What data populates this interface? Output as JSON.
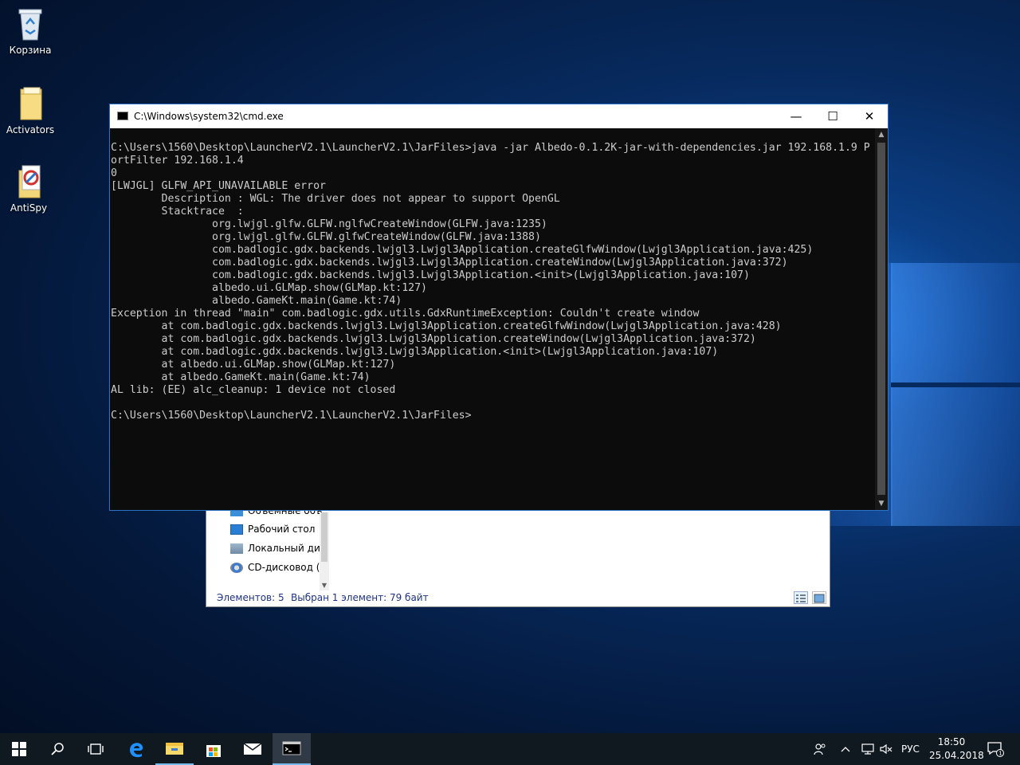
{
  "desktop": {
    "icons": [
      {
        "label": "Корзина"
      },
      {
        "label": "Activators"
      },
      {
        "label": "AntiSpy"
      }
    ]
  },
  "explorer": {
    "nav_items": [
      {
        "label": "Объемные объ"
      },
      {
        "label": "Рабочий стол"
      },
      {
        "label": "Локальный дис"
      },
      {
        "label": "CD-дисковод (D"
      }
    ],
    "status_count": "Элементов: 5",
    "status_selected": "Выбран 1 элемент: 79 байт"
  },
  "cmd": {
    "title": "C:\\Windows\\system32\\cmd.exe",
    "minimize": "—",
    "maximize": "☐",
    "close": "✕",
    "output": "C:\\Users\\1560\\Desktop\\LauncherV2.1\\LauncherV2.1\\JarFiles>java -jar Albedo-0.1.2K-jar-with-dependencies.jar 192.168.1.9 P\nortFilter 192.168.1.4\n0\n[LWJGL] GLFW_API_UNAVAILABLE error\n        Description : WGL: The driver does not appear to support OpenGL\n        Stacktrace  :\n                org.lwjgl.glfw.GLFW.nglfwCreateWindow(GLFW.java:1235)\n                org.lwjgl.glfw.GLFW.glfwCreateWindow(GLFW.java:1388)\n                com.badlogic.gdx.backends.lwjgl3.Lwjgl3Application.createGlfwWindow(Lwjgl3Application.java:425)\n                com.badlogic.gdx.backends.lwjgl3.Lwjgl3Application.createWindow(Lwjgl3Application.java:372)\n                com.badlogic.gdx.backends.lwjgl3.Lwjgl3Application.<init>(Lwjgl3Application.java:107)\n                albedo.ui.GLMap.show(GLMap.kt:127)\n                albedo.GameKt.main(Game.kt:74)\nException in thread \"main\" com.badlogic.gdx.utils.GdxRuntimeException: Couldn't create window\n        at com.badlogic.gdx.backends.lwjgl3.Lwjgl3Application.createGlfwWindow(Lwjgl3Application.java:428)\n        at com.badlogic.gdx.backends.lwjgl3.Lwjgl3Application.createWindow(Lwjgl3Application.java:372)\n        at com.badlogic.gdx.backends.lwjgl3.Lwjgl3Application.<init>(Lwjgl3Application.java:107)\n        at albedo.ui.GLMap.show(GLMap.kt:127)\n        at albedo.GameKt.main(Game.kt:74)\nAL lib: (EE) alc_cleanup: 1 device not closed\n\nC:\\Users\\1560\\Desktop\\LauncherV2.1\\LauncherV2.1\\JarFiles>"
  },
  "taskbar": {
    "icons": [
      "windows-start-icon",
      "search-icon",
      "task-view-icon",
      "edge-icon",
      "file-explorer-icon",
      "store-icon",
      "mail-icon",
      "cmd-icon"
    ],
    "language": "РУС",
    "time": "18:50",
    "date": "25.04.2018"
  },
  "colors": {
    "console_bg": "#0c0c0c",
    "console_text": "#cccccc",
    "taskbar_bg": "#101820",
    "accent": "#2b73c5"
  }
}
